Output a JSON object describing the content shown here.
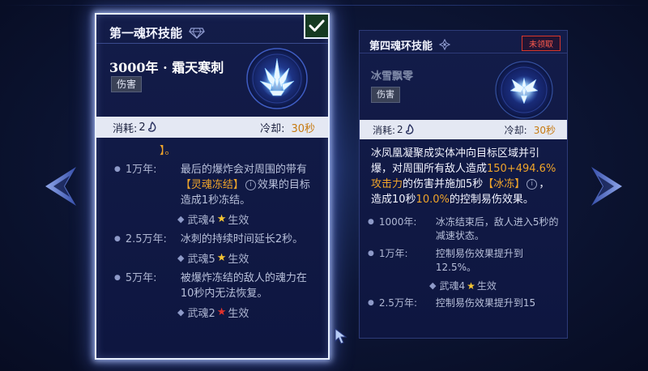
{
  "left_card": {
    "ring_title": "第一魂环技能",
    "selected": true,
    "skill_name": "3000年 · 霜天寒刺",
    "tag": "伤害",
    "cost_label": "消耗:",
    "cost_value": "2",
    "cooldown_label": "冷却:",
    "cooldown_value": "30秒",
    "desc_tail": "】。",
    "tiers": [
      {
        "year": "1万年:",
        "parts": [
          "最后的爆炸会对周围的带有",
          "【灵魂冻结】",
          "效果的目标造成1秒冻结。"
        ],
        "wuhun": "武魂4",
        "wuhun_star_color": "#f5c534",
        "wuhun_suffix": "生效"
      },
      {
        "year": "2.5万年:",
        "text": "冰刺的持续时间延长2秒。",
        "wuhun": "武魂5",
        "wuhun_star_color": "#f5c534",
        "wuhun_suffix": "生效"
      },
      {
        "year": "5万年:",
        "text": "被爆炸冻结的敌人的魂力在10秒内无法恢复。",
        "wuhun": "武魂2",
        "wuhun_star_color": "#e2322b",
        "wuhun_suffix": "生效"
      }
    ]
  },
  "right_card": {
    "ring_title": "第四魂环技能",
    "status_badge": "未领取",
    "skill_name": "冰雪飘零",
    "tag": "伤害",
    "cost_label": "消耗:",
    "cost_value": "2",
    "cooldown_label": "冷却:",
    "cooldown_value": "30秒",
    "description": {
      "p1": "冰凤凰凝聚成实体冲向目标区域并引爆，对周围所有敌人造成",
      "hl1": "150+494.6%攻击力",
      "p2": "的伤害并施加5秒",
      "hl2": "【冰冻】",
      "p3": "，造成10秒",
      "hl3": "10.0%",
      "p4": "的控制易伤效果。"
    },
    "tiers": [
      {
        "year": "1000年:",
        "text": "冰冻结束后，敌人进入5秒的减速状态。"
      },
      {
        "year": "1万年:",
        "text": "控制易伤效果提升到12.5%。",
        "wuhun": "武魂4",
        "wuhun_star_color": "#f5c534",
        "wuhun_suffix": "生效"
      },
      {
        "year": "2.5万年:",
        "text": "控制易伤效果提升到15"
      }
    ]
  },
  "colors": {
    "accent_orange": "#f0a52a",
    "star_gold": "#f5c534",
    "star_red": "#e2322b",
    "unclaimed_red": "#ff5b4d"
  }
}
